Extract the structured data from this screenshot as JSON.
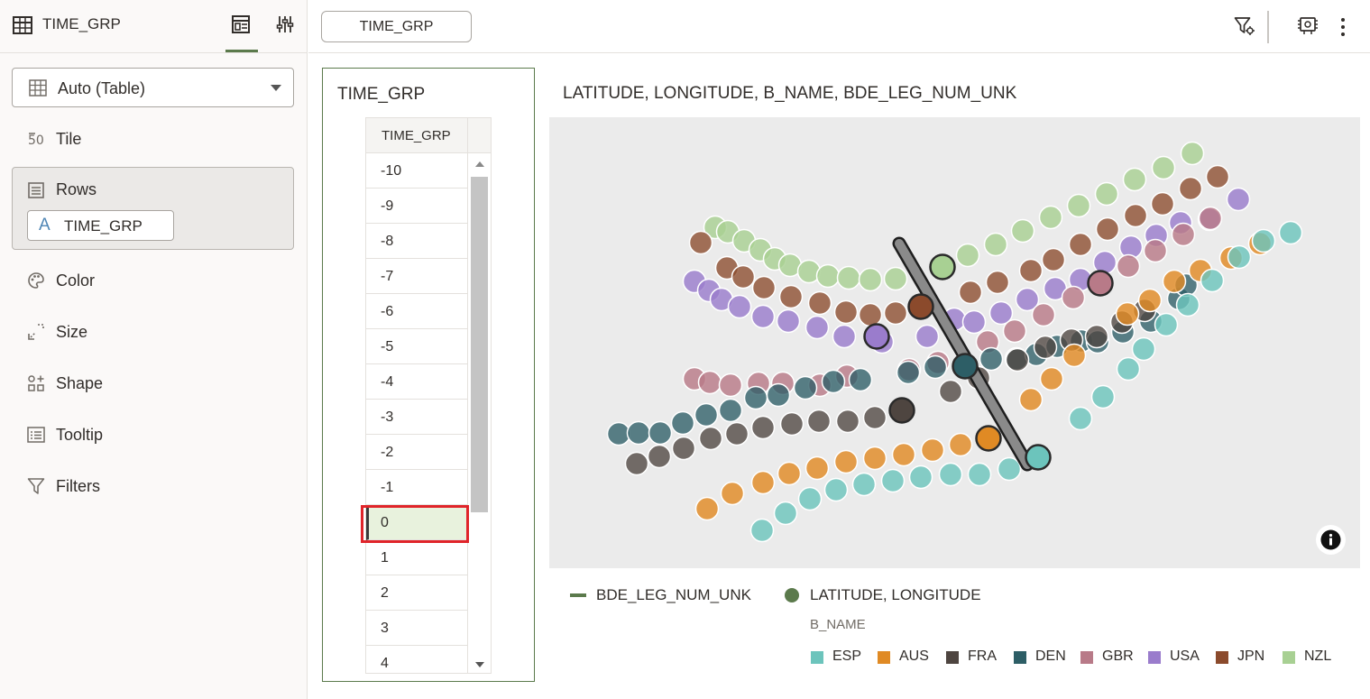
{
  "left_panel": {
    "title": "TIME_GRP",
    "viz_type": "Auto (Table)",
    "grammar": {
      "tile": "Tile",
      "rows": "Rows",
      "rows_pill": "TIME_GRP",
      "color": "Color",
      "size": "Size",
      "shape": "Shape",
      "tooltip": "Tooltip",
      "filters": "Filters"
    }
  },
  "top_bar": {
    "canvas_tab": "TIME_GRP"
  },
  "table_viz": {
    "title": "TIME_GRP",
    "column_header": "TIME_GRP",
    "rows": [
      "-10",
      "-9",
      "-8",
      "-7",
      "-6",
      "-5",
      "-4",
      "-3",
      "-2",
      "-1",
      "0",
      "1",
      "2",
      "3",
      "4"
    ],
    "selected_value": "0"
  },
  "map_viz": {
    "title": "LATITUDE, LONGITUDE, B_NAME, BDE_LEG_NUM_UNK",
    "legend": {
      "line_label": "BDE_LEG_NUM_UNK",
      "point_label": "LATITUDE, LONGITUDE",
      "color_title": "B_NAME",
      "categories": [
        {
          "name": "ESP",
          "color": "#6cc4bc"
        },
        {
          "name": "AUS",
          "color": "#e08a24"
        },
        {
          "name": "FRA",
          "color": "#4e4540"
        },
        {
          "name": "DEN",
          "color": "#2d5e66"
        },
        {
          "name": "GBR",
          "color": "#b87a88"
        },
        {
          "name": "USA",
          "color": "#9a7ccc"
        },
        {
          "name": "JPN",
          "color": "#8b4a2c"
        },
        {
          "name": "NZL",
          "color": "#a8d093"
        }
      ]
    }
  },
  "icons": {
    "table": "table-icon",
    "grammar_tab": "grammar-icon",
    "properties_tab": "sliders-icon",
    "filter_settings": "filter-settings-icon",
    "presentation": "presentation-icon",
    "more": "more-vertical-icon",
    "info": "info-icon"
  }
}
